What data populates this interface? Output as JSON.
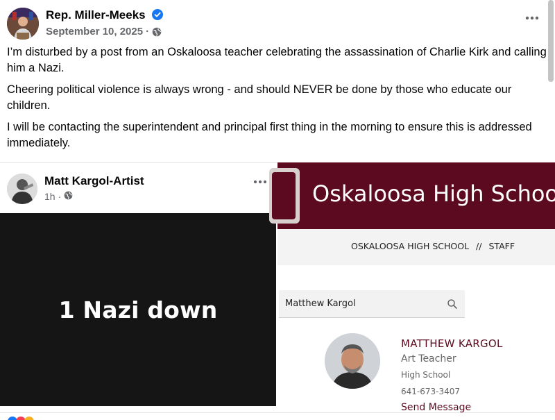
{
  "post": {
    "author": "Rep. Miller-Meeks",
    "date": "September 10, 2025",
    "separator": "·",
    "verified_icon": "verified-badge-icon",
    "privacy_icon": "globe-icon",
    "paragraphs": [
      "I’m disturbed by a post from an Oskaloosa teacher celebrating the assassination of Charlie Kirk and calling him a Nazi.",
      "Cheering political violence is always wrong - and should NEVER be done by those who educate our children.",
      "I will be contacting the superintendent and principal first thing in the morning to ensure this is addressed immediately."
    ]
  },
  "shared_card": {
    "author": "Matt Kargol-Artist",
    "time": "1h",
    "separator": "·",
    "text": "1 Nazi down"
  },
  "school": {
    "title": "Oskaloosa High School",
    "breadcrumb": [
      "OSKALOOSA HIGH SCHOOL",
      "//",
      "STAFF"
    ],
    "search_value": "Matthew Kargol",
    "staff": {
      "name": "MATTHEW KARGOL",
      "role": "Art Teacher",
      "building": "High School",
      "phone": "641-673-3407",
      "action": "Send Message"
    }
  },
  "colors": {
    "verified": "#1877f2",
    "maroon": "#5b0a1f",
    "meta_gray": "#65676b"
  }
}
